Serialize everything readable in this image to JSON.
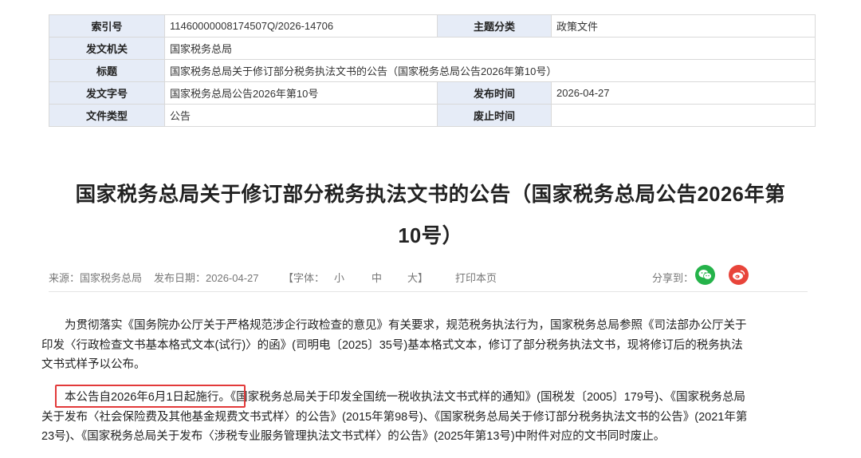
{
  "meta": {
    "index_label": "索引号",
    "index_value": "11460000008174507Q/2026-14706",
    "category_label": "主题分类",
    "category_value": "政策文件",
    "issuer_label": "发文机关",
    "issuer_value": "国家税务总局",
    "title_label": "标题",
    "title_value": "国家税务总局关于修订部分税务执法文书的公告（国家税务总局公告2026年第10号）",
    "docno_label": "发文字号",
    "docno_value": "国家税务总局公告2026年第10号",
    "pubdate_label": "发布时间",
    "pubdate_value": "2026-04-27",
    "type_label": "文件类型",
    "type_value": "公告",
    "repeal_label": "废止时间",
    "repeal_value": ""
  },
  "article": {
    "title_line1": "国家税务总局关于修订部分税务执法文书的公告（国家税务总局公告2026年第",
    "title_line2": "10号）"
  },
  "source": {
    "from": "来源：国家税务总局",
    "date": "发布日期：2026-04-27",
    "font_open": "【字体：",
    "font_small": "小",
    "font_medium": "中",
    "font_large": "大】",
    "print": "打印本页",
    "share": "分享到："
  },
  "body": {
    "p1_l1": "为贯彻落实《国务院办公厅关于严格规范涉企行政检查的意见》有关要求，规范税务执法行为，国家税务总局参照《司法部办公厅关于",
    "p1_l2": "印发〈行政检查文书基本格式文本(试行)〉的函》(司明电〔2025〕35号)基本格式文本，修订了部分税务执法文书，现将修订后的税务执法",
    "p1_l3": "文书式样予以公布。",
    "p2_highlight": "本公告自2026年6月1日起施行。",
    "p2_l1_rest": "《国家税务总局关于印发全国统一税收执法文书式样的通知》(国税发〔2005〕179号)、《国家税务总局",
    "p2_l2": "关于发布〈社会保险费及其他基金规费文书式样〉的公告》(2015年第98号)、《国家税务总局关于修订部分税务执法文书的公告》(2021年第",
    "p2_l3": "23号)、《国家税务总局关于发布〈涉税专业服务管理执法文书式样〉的公告》(2025年第13号)中附件对应的文书同时废止。"
  },
  "colors": {
    "label_bg": "#e6ecf7",
    "highlight_border": "#e23a3a",
    "wechat": "#25b34a",
    "weibo": "#e8443a"
  },
  "icons": [
    "wechat-icon",
    "weibo-icon"
  ]
}
